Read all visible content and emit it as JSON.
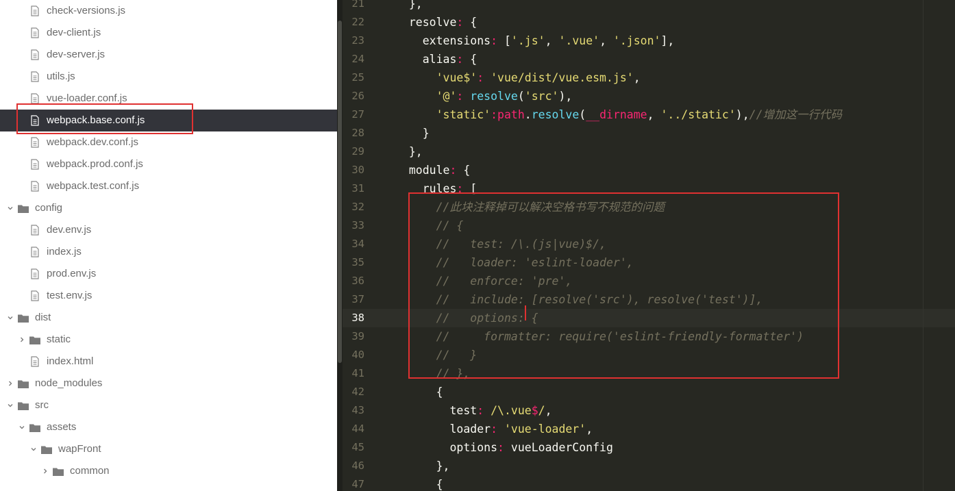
{
  "sidebar": {
    "items": [
      {
        "label": "check-versions.js",
        "kind": "file"
      },
      {
        "label": "dev-client.js",
        "kind": "file"
      },
      {
        "label": "dev-server.js",
        "kind": "file"
      },
      {
        "label": "utils.js",
        "kind": "file"
      },
      {
        "label": "vue-loader.conf.js",
        "kind": "file"
      },
      {
        "label": "webpack.base.conf.js",
        "kind": "file",
        "selected": true
      },
      {
        "label": "webpack.dev.conf.js",
        "kind": "file"
      },
      {
        "label": "webpack.prod.conf.js",
        "kind": "file"
      },
      {
        "label": "webpack.test.conf.js",
        "kind": "file"
      },
      {
        "label": "config",
        "kind": "folder",
        "expanded": true
      },
      {
        "label": "dev.env.js",
        "kind": "file"
      },
      {
        "label": "index.js",
        "kind": "file"
      },
      {
        "label": "prod.env.js",
        "kind": "file"
      },
      {
        "label": "test.env.js",
        "kind": "file"
      },
      {
        "label": "dist",
        "kind": "folder",
        "expanded": true
      },
      {
        "label": "static",
        "kind": "folder",
        "expanded": false
      },
      {
        "label": "index.html",
        "kind": "file"
      },
      {
        "label": "node_modules",
        "kind": "folder",
        "expanded": false
      },
      {
        "label": "src",
        "kind": "folder",
        "expanded": true
      },
      {
        "label": "assets",
        "kind": "folder",
        "expanded": true
      },
      {
        "label": "wapFront",
        "kind": "folder",
        "expanded": true
      },
      {
        "label": "common",
        "kind": "folder",
        "expanded": false
      }
    ]
  },
  "editor": {
    "active_line": "38",
    "lines": [
      {
        "n": "21",
        "code": "  },"
      },
      {
        "n": "22",
        "code": "  resolve: {"
      },
      {
        "n": "23",
        "code": "    extensions: ['.js', '.vue', '.json'],"
      },
      {
        "n": "24",
        "code": "    alias: {"
      },
      {
        "n": "25",
        "code": "      'vue$': 'vue/dist/vue.esm.js',"
      },
      {
        "n": "26",
        "code": "      '@': resolve('src'),"
      },
      {
        "n": "27",
        "code": "      'static':path.resolve(__dirname, '../static'),//增加这一行代码"
      },
      {
        "n": "28",
        "code": "    }"
      },
      {
        "n": "29",
        "code": "  },"
      },
      {
        "n": "30",
        "code": "  module: {"
      },
      {
        "n": "31",
        "code": "    rules: ["
      },
      {
        "n": "32",
        "code": "      //此块注释掉可以解决空格书写不规范的问题"
      },
      {
        "n": "33",
        "code": "      // {"
      },
      {
        "n": "34",
        "code": "      //   test: /\\.(js|vue)$/,"
      },
      {
        "n": "35",
        "code": "      //   loader: 'eslint-loader',"
      },
      {
        "n": "36",
        "code": "      //   enforce: 'pre',"
      },
      {
        "n": "37",
        "code": "      //   include: [resolve('src'), resolve('test')],"
      },
      {
        "n": "38",
        "code": "      //   options: {"
      },
      {
        "n": "39",
        "code": "      //     formatter: require('eslint-friendly-formatter')"
      },
      {
        "n": "40",
        "code": "      //   }"
      },
      {
        "n": "41",
        "code": "      // },"
      },
      {
        "n": "42",
        "code": "      {"
      },
      {
        "n": "43",
        "code": "        test: /\\.vue$/,"
      },
      {
        "n": "44",
        "code": "        loader: 'vue-loader',"
      },
      {
        "n": "45",
        "code": "        options: vueLoaderConfig"
      },
      {
        "n": "46",
        "code": "      },"
      },
      {
        "n": "47",
        "code": "      {"
      }
    ]
  },
  "colors": {
    "editor_bg": "#272822",
    "sidebar_bg": "#ffffff",
    "selected_row_bg": "#33343a",
    "highlight_border": "#e03131",
    "string": "#e6db74",
    "function": "#66d9ef",
    "operator": "#f92672",
    "comment": "#75715e"
  }
}
